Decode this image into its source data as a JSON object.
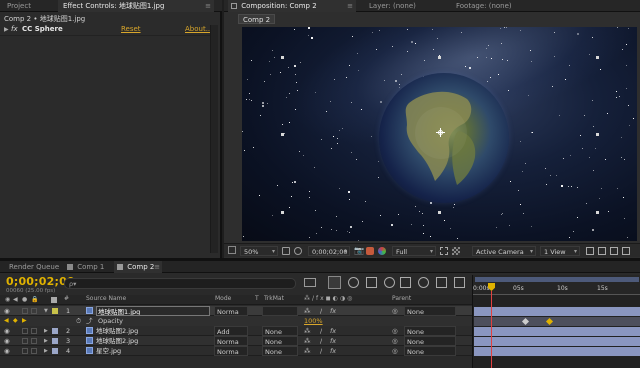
{
  "top_tabs": {
    "project": "Project",
    "effect_controls": "Effect Controls: 地球贴图1.jpg",
    "composition": "Composition: Comp 2",
    "layer": "Layer: (none)",
    "footage": "Footage: (none)"
  },
  "effect_controls": {
    "breadcrumb": "Comp 2 • 地球贴图1.jpg",
    "fx_badge": "fx",
    "effect_name": "CC Sphere",
    "reset": "Reset",
    "about": "About..."
  },
  "composition": {
    "comp_tab": "Comp 2",
    "viewer_toolbar": {
      "zoom": "50%",
      "timecode": "0;00;02;00",
      "resolution": "Full",
      "camera": "Active Camera",
      "view_layout": "1 View"
    }
  },
  "bottom_tabs": {
    "render_queue": "Render Queue",
    "comp1": "Comp 1",
    "comp2": "Comp 2"
  },
  "timeline": {
    "current_time": "0;00;02;00",
    "frame_info": "00060 (25.00 fps)",
    "search_placeholder": "ρ▾",
    "headers": {
      "source_name": "Source Name",
      "mode": "Mode",
      "t": "T",
      "trkmat": "TrkMat",
      "parent": "Parent"
    },
    "layers": [
      {
        "num": "1",
        "name": "地球贴图1.jpg",
        "mode": "Norma",
        "trkmat": "",
        "parent": "None",
        "label_color": "#c8c24a",
        "selected": true
      },
      {
        "num": "2",
        "name": "地球贴图2.jpg",
        "mode": "Add",
        "trkmat": "None",
        "parent": "None",
        "label_color": "#9aa6c8",
        "selected": false
      },
      {
        "num": "3",
        "name": "地球贴图2.jpg",
        "mode": "Norma",
        "trkmat": "None",
        "parent": "None",
        "label_color": "#9aa6c8",
        "selected": false
      },
      {
        "num": "4",
        "name": "星空.jpg",
        "mode": "Norma",
        "trkmat": "None",
        "parent": "None",
        "label_color": "#9aa6c8",
        "selected": false
      }
    ],
    "opacity_label": "Opacity",
    "opacity_value": "100%",
    "ruler": [
      "0:00s",
      "05s",
      "10s",
      "15s"
    ]
  },
  "colors": {
    "accent": "#d8a62b",
    "playhead": "#e04040",
    "work_area": "#8e98bd",
    "timecode": "#e0b200"
  }
}
